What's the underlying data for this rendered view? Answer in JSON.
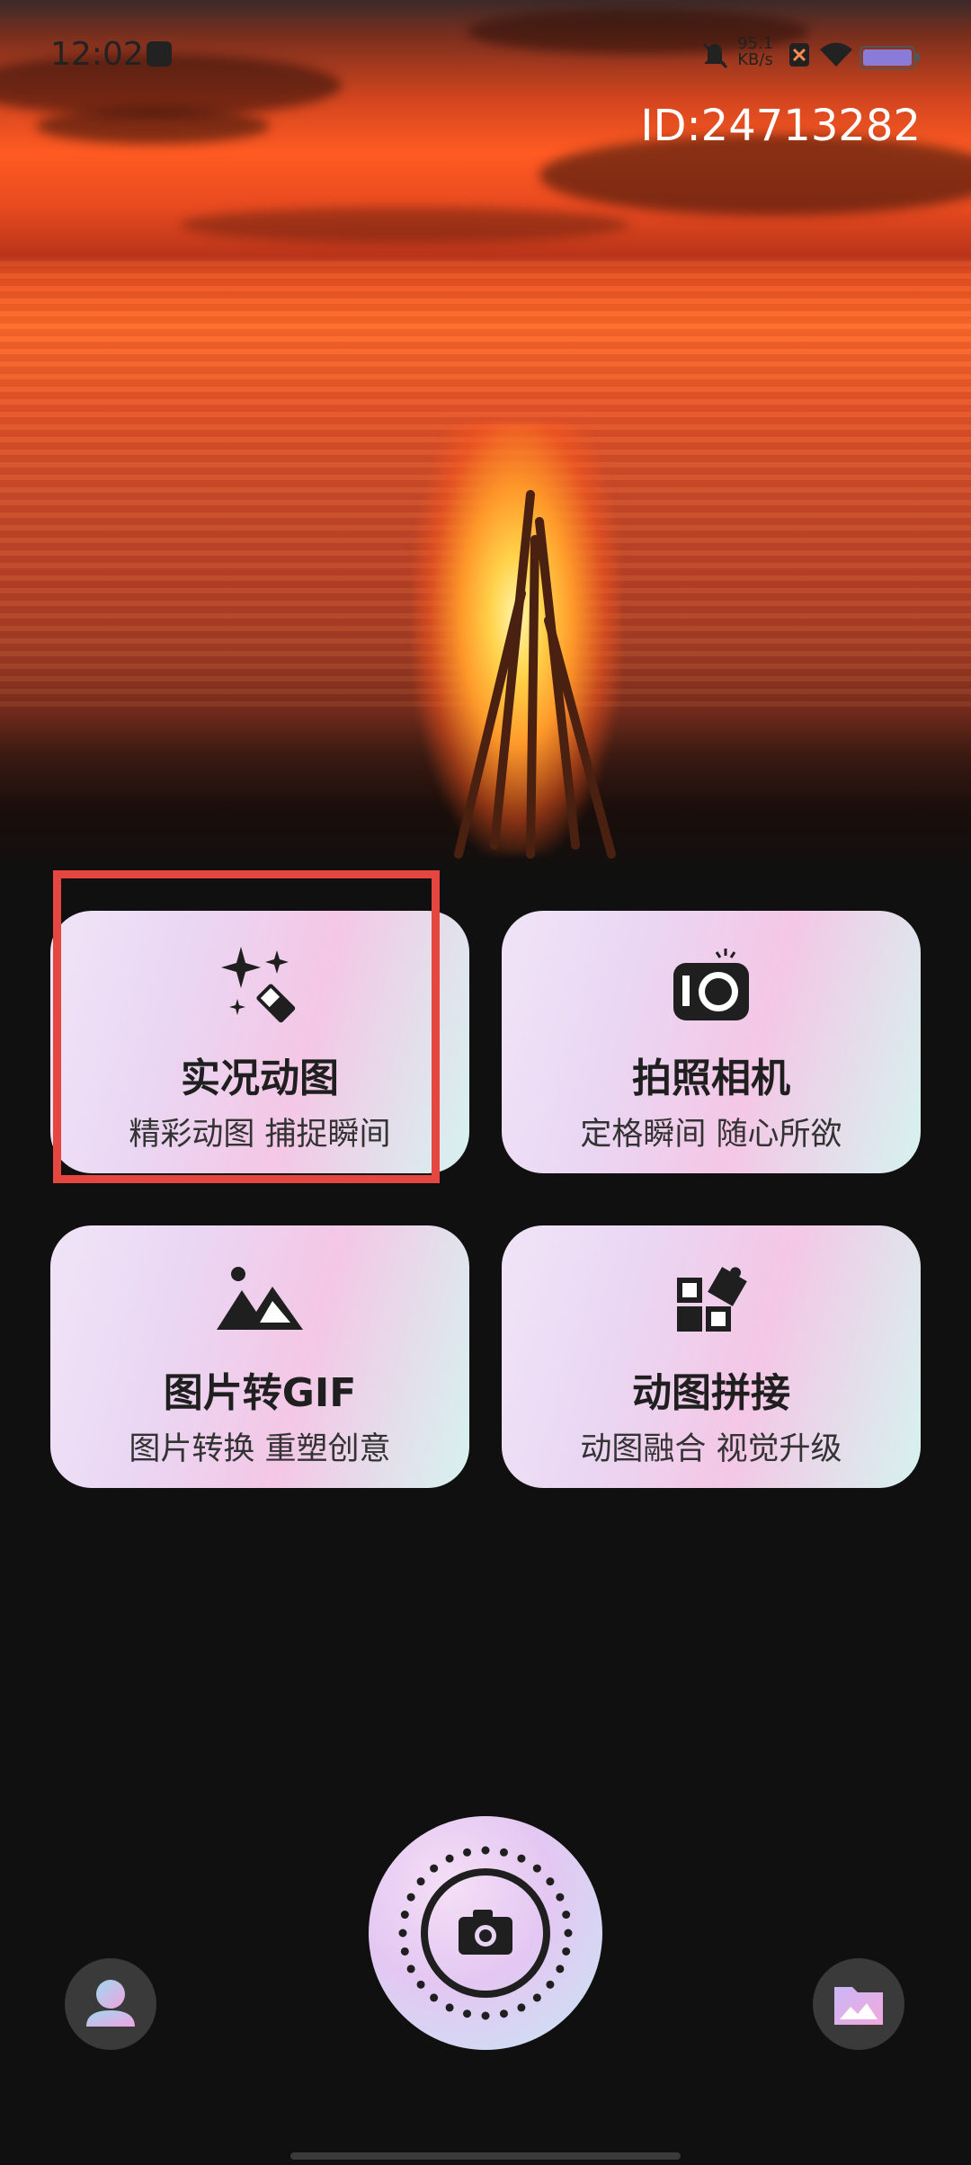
{
  "status_bar": {
    "time": "12:02",
    "net_speed_value": "95.1",
    "net_speed_unit": "KB/s"
  },
  "header": {
    "id_text": "ID:24713282"
  },
  "cards": [
    {
      "title": "实况动图",
      "subtitle": "精彩动图 捕捉瞬间",
      "icon": "sparkle-wand-icon"
    },
    {
      "title": "拍照相机",
      "subtitle": "定格瞬间 随心所欲",
      "icon": "camera-icon"
    },
    {
      "title": "图片转GIF",
      "subtitle": "图片转换 重塑创意",
      "icon": "mountain-image-icon"
    },
    {
      "title": "动图拼接",
      "subtitle": "动图融合 视觉升级",
      "icon": "puzzle-icon"
    }
  ],
  "colors": {
    "highlight": "#e5463f",
    "background": "#101010",
    "card_gradient": [
      "#f1e4f7",
      "#f4c7e6",
      "#d6f2ef"
    ]
  }
}
